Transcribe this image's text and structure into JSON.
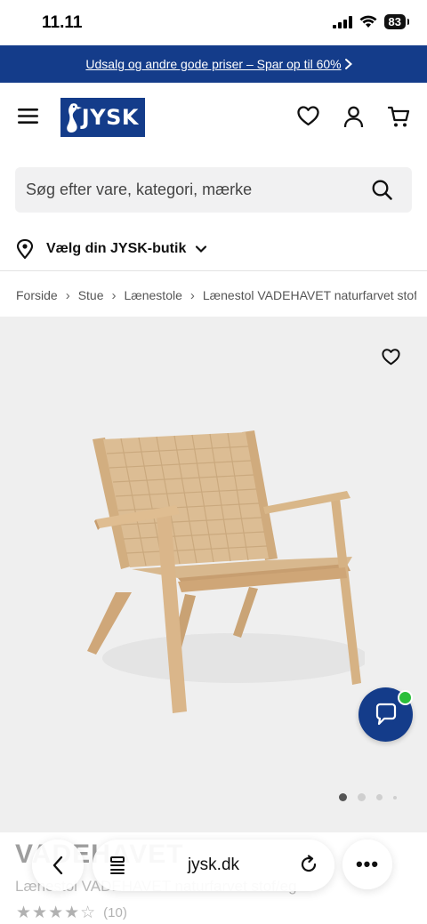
{
  "status_bar": {
    "time": "11.11",
    "battery": "83"
  },
  "promo": {
    "text": "Udsalg og andre gode priser – Spar op til 60%"
  },
  "header": {
    "logo_text": "JYSK"
  },
  "search": {
    "placeholder": "Søg efter vare, kategori, mærke"
  },
  "store": {
    "label": "Vælg din JYSK-butik"
  },
  "breadcrumb": [
    "Forside",
    "Stue",
    "Lænestole",
    "Lænestol VADEHAVET naturfarvet stofteg"
  ],
  "gallery": {
    "image_count": 4,
    "active_index": 0
  },
  "product": {
    "title": "VADEHAVET",
    "subtitle": "Lænestol VADEHAVET naturfarvet stof/eg",
    "rating": 4,
    "rating_max": 5,
    "review_count": "(10)"
  },
  "browser": {
    "url": "jysk.dk"
  },
  "colors": {
    "brand_blue": "#143c8a",
    "online_green": "#2bbf3a"
  }
}
